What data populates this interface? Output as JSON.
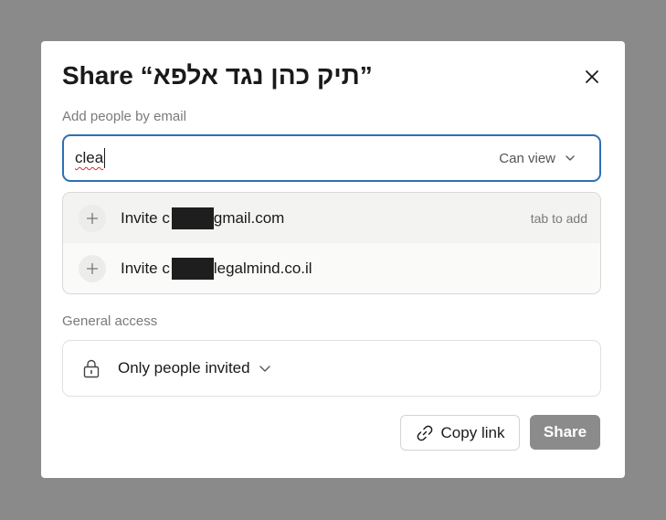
{
  "dialog": {
    "title": "Share “תיק כהן נגד אלפא”"
  },
  "add_people": {
    "label": "Add people by email",
    "input_value": "clea",
    "permission": "Can view"
  },
  "suggestions": [
    {
      "prefix": "Invite c",
      "suffix": "gmail.com",
      "hint": "tab to add"
    },
    {
      "prefix": "Invite c",
      "suffix": "legalmind.co.il",
      "hint": ""
    }
  ],
  "general_access": {
    "label": "General access",
    "value": "Only people invited"
  },
  "buttons": {
    "copy_link": "Copy link",
    "share": "Share"
  },
  "colors": {
    "backdrop": "#8a8a8a",
    "input_focus_border": "#2f6fb4",
    "share_button": "#8b8b8b"
  },
  "icons": {
    "close": "close-icon",
    "plus": "plus-icon",
    "lock": "lock-icon",
    "chevron": "chevron-down-icon",
    "link": "link-icon"
  }
}
